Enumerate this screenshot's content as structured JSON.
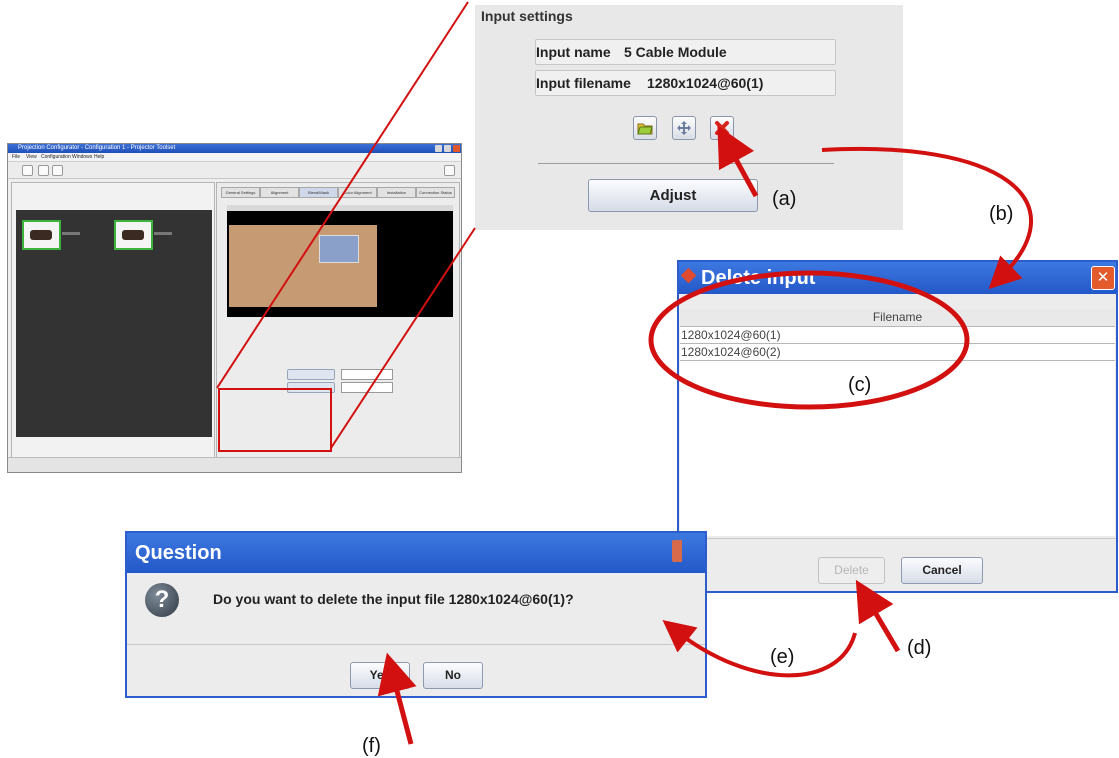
{
  "mini_app": {
    "title": "Projection Configurator - Configuration 1 - Projector Toolset",
    "menu": [
      "File",
      "View",
      "Configuration",
      "Windows",
      "Help"
    ],
    "tabs": [
      "General Settings",
      "Alignment",
      "Blend/Mask",
      "Color Alignment",
      "Installation",
      "Connection Status"
    ]
  },
  "input_settings": {
    "legend": "Input settings",
    "input_name_label": "Input name",
    "input_name_value": "5 Cable Module",
    "input_filename_label": "Input filename",
    "input_filename_value": "1280x1024@60(1)",
    "open_icon": "folder-icon",
    "move_icon": "move-arrows-icon",
    "delete_icon": "red-x-icon",
    "adjust_label": "Adjust"
  },
  "delete_dialog": {
    "title": "Delete input",
    "close_icon": "close-icon",
    "column_header": "Filename",
    "rows": [
      "1280x1024@60(1)",
      "1280x1024@60(2)"
    ],
    "delete_label": "Delete",
    "cancel_label": "Cancel"
  },
  "question_dialog": {
    "title": "Question",
    "icon": "question-icon",
    "message": "Do you want to delete the input file 1280x1024@60(1)?",
    "yes_label": "Yes",
    "no_label": "No"
  },
  "callouts": {
    "a": "(a)",
    "b": "(b)",
    "c": "(c)",
    "d": "(d)",
    "e": "(e)",
    "f": "(f)"
  },
  "colors": {
    "annotation_red": "#d21010",
    "title_blue": "#2d5ccd",
    "panel_gray": "#ececec"
  }
}
